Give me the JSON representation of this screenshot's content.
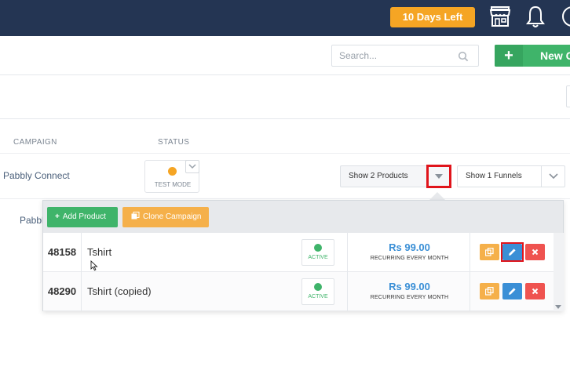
{
  "topbar": {
    "trial_label": "10 Days Left"
  },
  "header": {
    "search_placeholder": "Search...",
    "new_button_label": "New C"
  },
  "table": {
    "columns": [
      "CAMPAIGN",
      "STATUS"
    ],
    "rows": [
      {
        "campaign": "Pabbly Connect",
        "status": "TEST MODE",
        "products_select": "Show 2 Products",
        "funnels_select": "Show 1 Funnels"
      },
      {
        "campaign": "Pabbly"
      }
    ]
  },
  "dropdown": {
    "add_product_label": "Add Product",
    "clone_campaign_label": "Clone Campaign",
    "products": [
      {
        "id": "48158",
        "name": "Tshirt",
        "status": "ACTIVE",
        "price": "Rs 99.00",
        "period": "RECURRING EVERY MONTH"
      },
      {
        "id": "48290",
        "name": "Tshirt (copied)",
        "status": "ACTIVE",
        "price": "Rs 99.00",
        "period": "RECURRING EVERY MONTH"
      }
    ]
  },
  "colors": {
    "topbar_bg": "#243553",
    "trial_badge": "#f5a524",
    "primary_green": "#3fb46a",
    "clone_orange": "#f5b04a",
    "edit_blue": "#3a8fd6",
    "delete_red": "#ef5350",
    "highlight_red": "#e0141b",
    "test_mode_dot": "#f5a524"
  },
  "icons": {
    "store": "store-icon",
    "notifications": "bell-icon",
    "profile": "avatar-icon",
    "search": "search-icon",
    "copy": "copy-icon",
    "edit": "pencil-icon",
    "delete": "close-icon"
  }
}
